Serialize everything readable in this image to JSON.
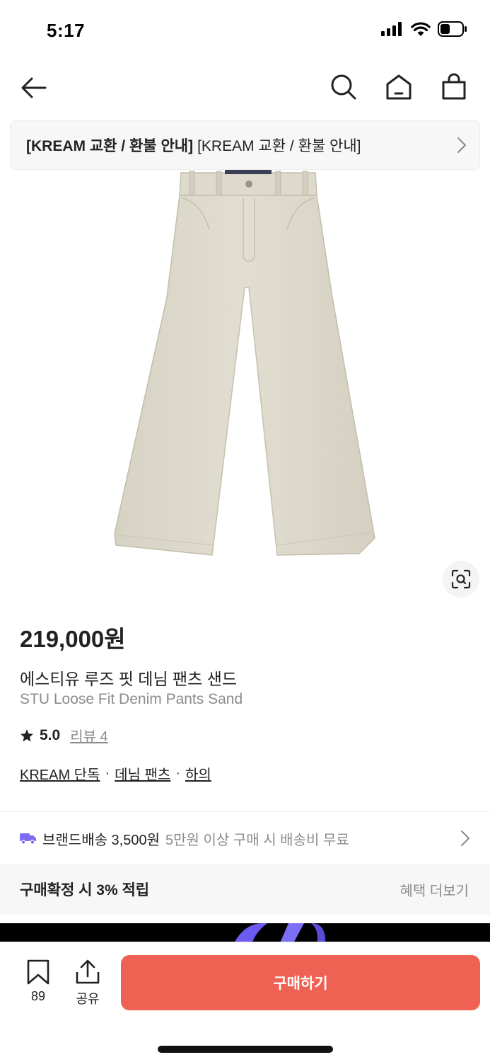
{
  "status": {
    "time": "5:17",
    "battery_percent": 45
  },
  "notice": {
    "bold": "[KREAM 교환 / 환불 안내]",
    "normal": "[KREAM 교환 / 환불 안내]"
  },
  "product": {
    "price": "219,000원",
    "name_ko": "에스티유 루즈 핏 데님 팬츠 샌드",
    "name_en": "STU Loose Fit Denim Pants Sand",
    "rating": "5.0",
    "review_label": "리뷰 4",
    "categories": [
      "KREAM 단독",
      "데님 팬츠",
      "하의"
    ],
    "category_separator": "·"
  },
  "shipping": {
    "label": "브랜드배송 3,500원",
    "sub": "5만원 이상 구매 시 배송비 무료",
    "icon": "truck-icon",
    "icon_color": "#7b6cf6"
  },
  "points": {
    "text": "구매확정 시 3% 적립",
    "more": "혜택 더보기"
  },
  "bottom": {
    "bookmark_count": "89",
    "share_label": "공유",
    "buy_label": "구매하기",
    "buy_color": "#ef6253"
  }
}
